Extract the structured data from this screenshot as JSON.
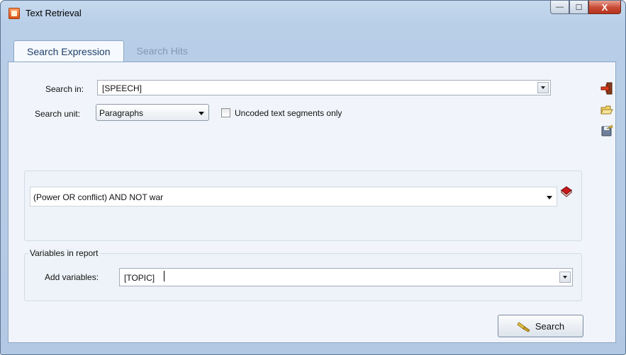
{
  "window": {
    "title": "Text Retrieval",
    "controls": {
      "minimize": "—",
      "maximize": "☐",
      "close": "X"
    }
  },
  "tabs": [
    {
      "label": "Search Expression",
      "active": true
    },
    {
      "label": "Search Hits",
      "active": false
    }
  ],
  "search_in": {
    "label": "Search in:",
    "value": "[SPEECH]"
  },
  "search_unit": {
    "label": "Search unit:",
    "value": "Paragraphs"
  },
  "uncoded_only": {
    "label": "Uncoded text segments only",
    "checked": false
  },
  "expression": {
    "value": "(Power OR conflict) AND NOT war"
  },
  "variables": {
    "group_title": "Variables in report",
    "label": "Add variables:",
    "value": "[TOPIC]"
  },
  "search_button": {
    "label": "Search"
  },
  "side_toolbar": [
    "exit-icon",
    "open-folder-icon",
    "save-icon"
  ],
  "colors": {
    "title_bar": "#b9cfe8",
    "panel": "#f1f5fb",
    "accent": "#1d3f6e"
  }
}
